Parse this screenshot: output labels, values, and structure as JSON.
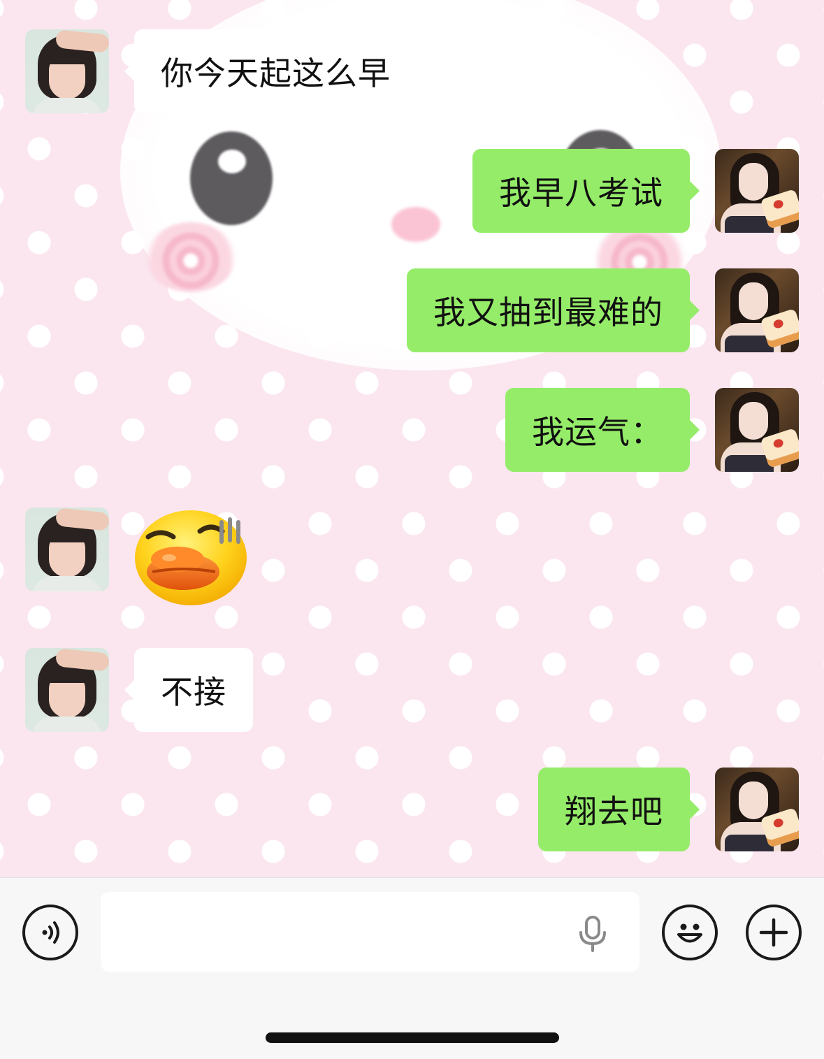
{
  "conversation": {
    "messages": [
      {
        "sender": "friend",
        "type": "text",
        "text": "你今天起这么早"
      },
      {
        "sender": "me",
        "type": "text",
        "text": "我早八考试"
      },
      {
        "sender": "me",
        "type": "text",
        "text": "我又抽到最难的"
      },
      {
        "sender": "me",
        "type": "text",
        "text": "我运气："
      },
      {
        "sender": "friend",
        "type": "sticker",
        "icon": "duck-face-sweat-sticker"
      },
      {
        "sender": "friend",
        "type": "text",
        "text": "不接"
      },
      {
        "sender": "me",
        "type": "text",
        "text": "翔去吧"
      }
    ]
  },
  "input_bar": {
    "text_value": "",
    "icons": {
      "voice": "voice-icon",
      "mic": "mic-icon",
      "emoji": "emoji-icon",
      "plus": "plus-icon"
    }
  },
  "colors": {
    "outgoing_bubble": "#95ec69",
    "incoming_bubble": "#ffffff",
    "wallpaper": "#fbe6ef",
    "input_bar": "#f7f7f7"
  }
}
